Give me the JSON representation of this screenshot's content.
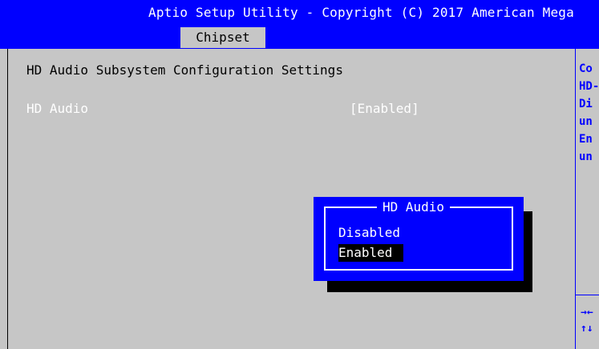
{
  "header": {
    "title": "Aptio Setup Utility - Copyright (C) 2017 American Mega",
    "active_tab": "Chipset"
  },
  "main": {
    "section_heading": "HD Audio Subsystem Configuration Settings",
    "settings": [
      {
        "label": "HD Audio",
        "value": "[Enabled]"
      }
    ]
  },
  "help": {
    "lines": [
      "Co",
      "HD-",
      "Di",
      "un",
      "En",
      "un"
    ],
    "nav": [
      "→←",
      "↑↓"
    ]
  },
  "popup": {
    "title": "HD Audio",
    "options": [
      "Disabled",
      "Enabled"
    ],
    "selected": "Enabled"
  },
  "colors": {
    "bios_blue": "#0000ff",
    "background_gray": "#c6c6c6",
    "text_white": "#ffffff",
    "selection_black": "#000000"
  }
}
